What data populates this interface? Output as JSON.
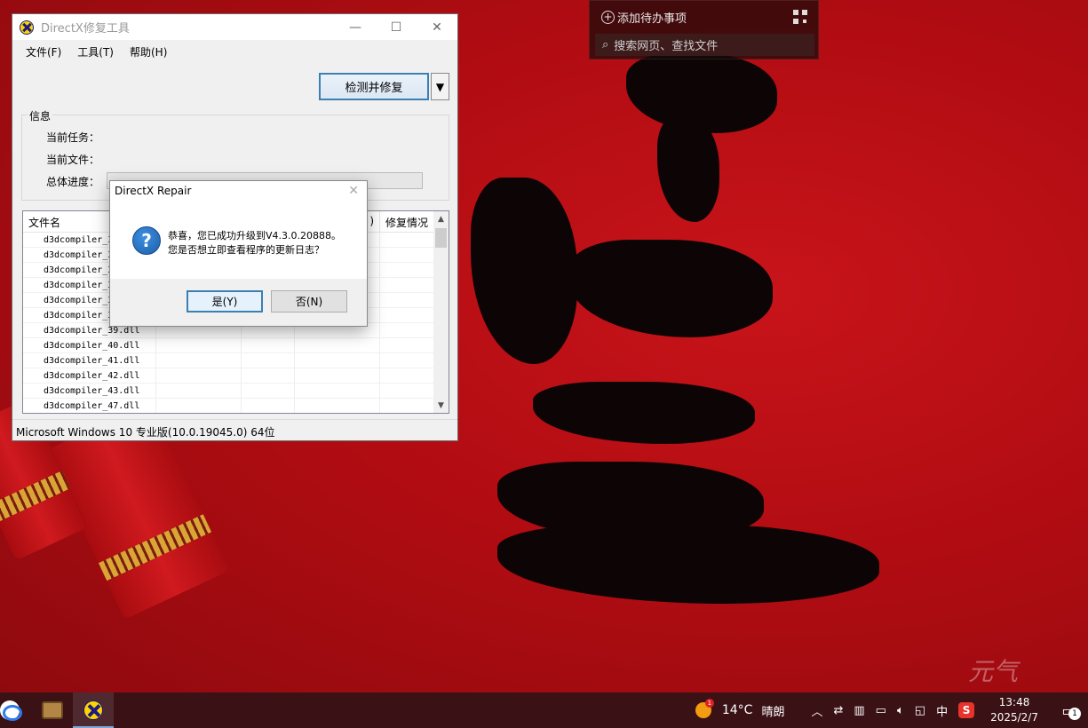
{
  "widget": {
    "todo_label": "添加待办事项",
    "search_placeholder": "搜索网页、查找文件"
  },
  "window": {
    "title": "DirectX修复工具",
    "menu": [
      "文件(F)",
      "工具(T)",
      "帮助(H)"
    ],
    "detect_button": "检测并修复",
    "info_title": "信息",
    "current_task_label": "当前任务：",
    "current_file_label": "当前文件：",
    "progress_label": "总体进度：",
    "progress_value": 0,
    "columns": [
      "文件名",
      "",
      "",
      "",
      ")",
      "修复情况"
    ],
    "files": [
      "d3dcompiler_3",
      "d3dcompiler_3",
      "d3dcompiler_3",
      "d3dcompiler_3",
      "d3dcompiler_3",
      "d3dcompiler_3",
      "d3dcompiler_39.dll",
      "d3dcompiler_40.dll",
      "d3dcompiler_41.dll",
      "d3dcompiler_42.dll",
      "d3dcompiler_43.dll",
      "d3dcompiler_47.dll"
    ],
    "status": "Microsoft Windows 10 专业版(10.0.19045.0) 64位"
  },
  "dialog": {
    "title": "DirectX Repair",
    "line1": "恭喜，您已成功升级到V4.3.0.20888。",
    "line2": "您是否想立即查看程序的更新日志？",
    "yes_label": "是(Y)",
    "no_label": "否(N)"
  },
  "watermark": "元气",
  "taskbar": {
    "weather_badge": "1",
    "temperature": "14°C",
    "weather": "晴朗",
    "ime": "中",
    "sogou": "S",
    "time": "13:48",
    "date": "2025/2/7",
    "notif_count": "1"
  }
}
